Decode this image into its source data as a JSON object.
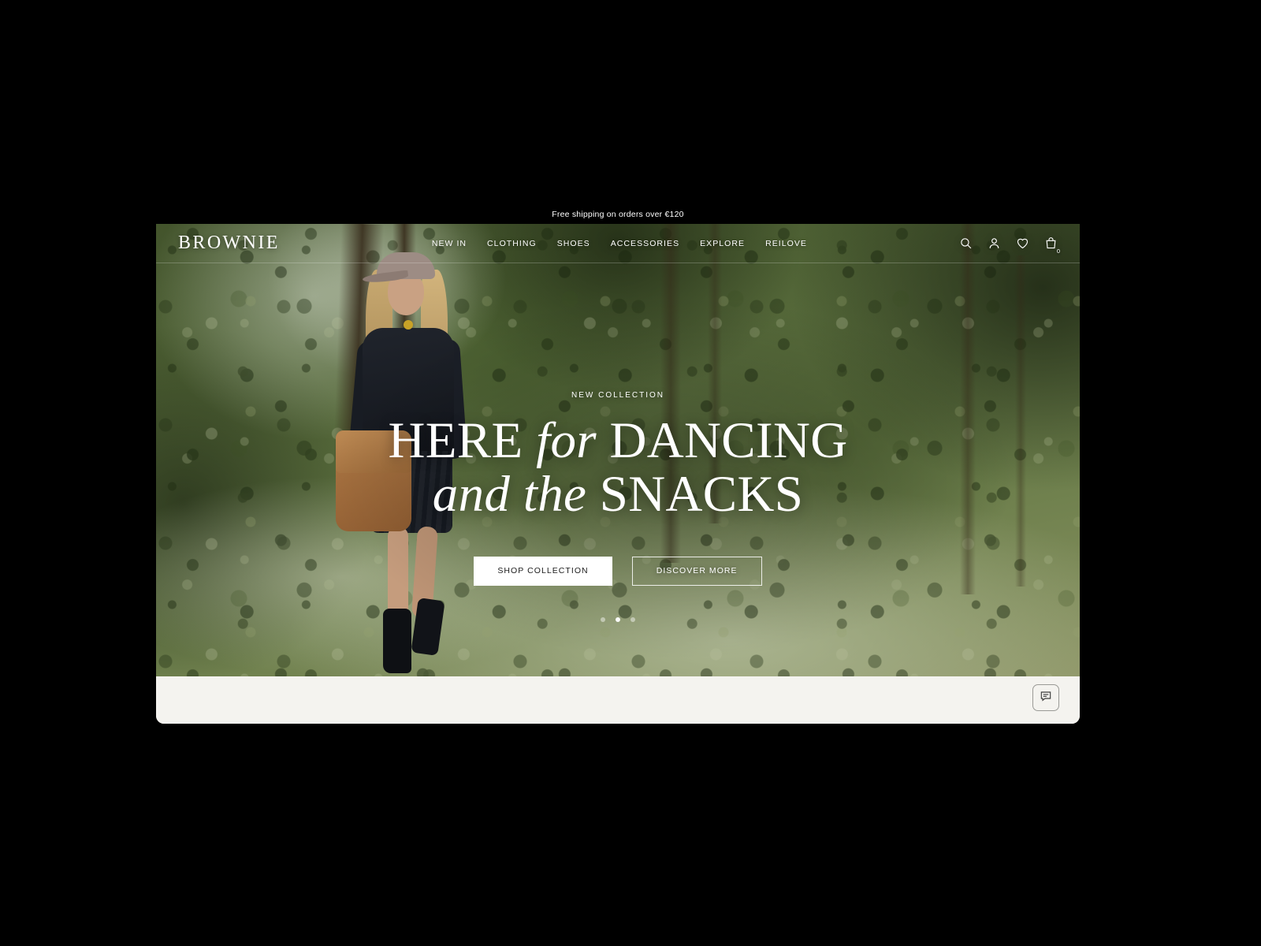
{
  "announcement": {
    "text": "Free shipping on orders over €120",
    "background": "#000000",
    "color": "#ffffff"
  },
  "nav": {
    "logo": "BROWNIE",
    "menu": [
      {
        "label": "NEW IN",
        "name": "new-in"
      },
      {
        "label": "CLOTHING",
        "name": "clothing"
      },
      {
        "label": "SHOES",
        "name": "shoes"
      },
      {
        "label": "ACCESSORIES",
        "name": "accessories"
      },
      {
        "label": "EXPLORE",
        "name": "explore"
      },
      {
        "label": "REILOVE",
        "name": "reilove"
      }
    ],
    "actions": [
      {
        "icon": "search-icon"
      },
      {
        "icon": "user-icon"
      },
      {
        "icon": "heart-icon"
      },
      {
        "icon": "cart-icon"
      }
    ],
    "cart_count": "0"
  },
  "hero": {
    "eyebrow": "NEW COLLECTION",
    "headline_line1_a": "HERE ",
    "headline_line1_it": "for",
    "headline_line1_b": " DANCING",
    "headline_line2_it": "and the",
    "headline_line2_b": " SNACKS",
    "primary_cta": "SHOP COLLECTION",
    "secondary_cta": "DISCOVER MORE",
    "slides": 3,
    "active_slide": 1,
    "text_color": "#ffffff"
  },
  "chat": {
    "icon": "chat-bubble-icon"
  },
  "theme": {
    "page_background": "#000000",
    "section_background": "#f4f3ef",
    "button_fill": "#ffffff",
    "button_text": "#1b1b1b"
  }
}
